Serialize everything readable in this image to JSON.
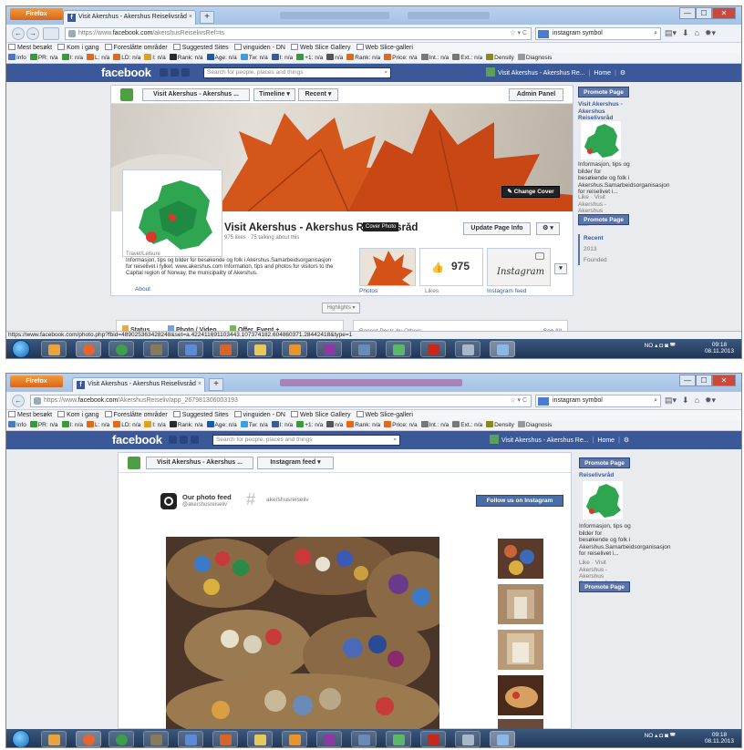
{
  "browser": {
    "menu_label": "Firefox",
    "win_min": "—",
    "win_max": "☐",
    "win_close": "✕",
    "search_query": "instagram symbol",
    "search_icon_glyph": "⌕",
    "url_nav_glyph": "☆ ▾ C",
    "back_glyph": "←",
    "forward_glyph": "→",
    "newtab_glyph": "+",
    "tab_close_glyph": "×"
  },
  "bookmarks": [
    "Mest besøkt",
    "Kom i gang",
    "Foreslåtte områder",
    "Suggested Sites",
    "vinguiden - DN",
    "Web Slice Gallery",
    "Web Slice-galleri"
  ],
  "seo_items": [
    {
      "label": "Info",
      "color": "#4a78c9"
    },
    {
      "label": "PR: n/a",
      "color": "#3a9a3a"
    },
    {
      "label": "I: n/a",
      "color": "#3a9a3a"
    },
    {
      "label": "L: n/a",
      "color": "#e06a1a"
    },
    {
      "label": "LD: n/a",
      "color": "#e06a1a"
    },
    {
      "label": "I: n/a",
      "color": "#e0a01a"
    },
    {
      "label": "Rank: n/a",
      "color": "#2a2a2a"
    },
    {
      "label": "Age: n/a",
      "color": "#1a5aaa"
    },
    {
      "label": "Tw: n/a",
      "color": "#3aa0e0"
    },
    {
      "label": "I: n/a",
      "color": "#3b5998"
    },
    {
      "label": "+1: n/a",
      "color": "#3a9a3a"
    },
    {
      "label": "n/a",
      "color": "#555555"
    },
    {
      "label": "Rank: n/a",
      "color": "#e06a1a"
    },
    {
      "label": "Price: n/a",
      "color": "#e06a1a"
    },
    {
      "label": "Int.: n/a",
      "color": "#777777"
    },
    {
      "label": "Ext.: n/a",
      "color": "#777777"
    },
    {
      "label": "Density",
      "color": "#8a8a1a"
    },
    {
      "label": "Diagnosis",
      "color": "#999999"
    }
  ],
  "facebook": {
    "logo": "facebook",
    "search_placeholder": "Search for people, places and things",
    "page_short": "Visit Akershus - Akershus Re...",
    "home": "Home",
    "settings_glyph": "⚙"
  },
  "shot1": {
    "tab_title": "Visit Akershus - Akershus Reiselivsråd",
    "url_domain": "facebook.com",
    "url_path": "/akershusReiselivsRef=ts",
    "url_prefix": "https://www.",
    "page_nav_name": "Visit Akershus - Akershus ...",
    "timeline": "Timeline ▾",
    "recent": "Recent ▾",
    "admin_panel": "Admin Panel",
    "change_cover": "✎ Change Cover",
    "page_title": "Visit Akershus - Akershus Reiselivsråd",
    "stats": "975 likes · 75 talking about this",
    "tooltip": "Cover Photo",
    "update_info": "Update Page Info",
    "gear": "⚙ ▾",
    "category": "Travel/Leisure",
    "about_text": "Informasjon, tips og bilder for besøkende og folk i Akershus.Samarbeidsorganisasjon for reiselivet i fylket. www.akershus.com Information, tips and photos for visitors to the Capital region of Norway, the municipality of Akershus.",
    "about_link": "About",
    "photos_label": "Photos",
    "likes_count": "975",
    "likes_label": "Likes",
    "instagram_word": "Instagram",
    "instagram_label": "Instagram feed",
    "highlights": "Highlights ▾",
    "composer": [
      "Status",
      "Photo / Video",
      "Offer, Event +"
    ],
    "recent_posts": "Recent Posts by Others",
    "see_all": "See All",
    "status_url": "https://www.facebook.com/photo.php?fbid=489025363428248&set=a.422411691103443.107374182.604860371.28442418&type=1",
    "sidebar_promote": "Promote Page",
    "sidebar_name": "Visit Akershus - Akershus Reiselivsråd",
    "sidebar_desc": "Informasjon, tips og bilder for besøkende og folk i Akershus.Samarbeidsorganisasjon for reiselivet i...",
    "sidebar_like": "Like · Visit Akershus - Akershus Reiselivsråd likes this.",
    "sidebar_promote2": "Promote Page",
    "timeline_recent": "Recent",
    "timeline_year": "2013",
    "timeline_founded": "Founded",
    "tray": "NO",
    "time": "09:18",
    "date": "08.11.2013"
  },
  "shot2": {
    "tab_title": "Visit Akershus - Akershus Reiselivsråd",
    "url_prefix": "https://www.",
    "url_domain": "facebook.com",
    "url_path": "/AkershusReiseliv/app_267981306003193",
    "page_nav_name": "Visit Akershus - Akershus ...",
    "app_dropdown": "Instagram feed ▾",
    "feed_title": "Our photo feed",
    "feed_handle": "@akershusreiseliv",
    "hashtag": "akershusreiseliv",
    "follow_btn": "Follow us on Instagram",
    "sidebar_promote": "Promote Page",
    "sidebar_name": "Reiselivsråd",
    "sidebar_desc": "Informasjon, tips og bilder for besøkende og folk i Akershus.Samarbeidsorganisasjon for reiselivet i...",
    "sidebar_like": "Like · Visit Akershus - Akershus Reiselivsråd likes this.",
    "sidebar_promote2": "Promote Page",
    "tray": "NO",
    "time": "09:18",
    "date": "08.11.2013"
  },
  "colors": {
    "facebook_blue": "#3b5998",
    "firefox_orange": "#e87d2a",
    "taskbar": "#2a4468"
  }
}
